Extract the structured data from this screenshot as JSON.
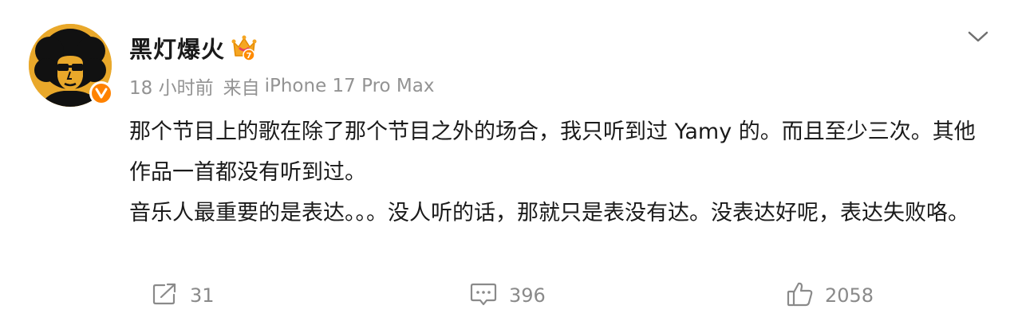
{
  "post": {
    "username": "黑灯爆火",
    "time": "18 小时前",
    "from_label": "来自",
    "device": "iPhone 17 Pro Max",
    "vip_level": "7",
    "paragraphs": [
      "那个节目上的歌在除了那个节目之外的场合，我只听到过 Yamy 的。而且至少三次。其他作品一首都没有听到过。",
      "音乐人最重要的是表达。。。没人听的话，那就只是表没有达。没表达好呢，表达失败咯。"
    ]
  },
  "actions": {
    "repost": {
      "icon": "repost-icon",
      "count": "31"
    },
    "comment": {
      "icon": "comment-icon",
      "count": "396"
    },
    "like": {
      "icon": "thumbs-up-icon",
      "count": "2058"
    }
  },
  "colors": {
    "username": "#1a1a1a",
    "meta": "#939393",
    "counts": "#8a8a8a",
    "verified_badge": "#ff8200",
    "avatar_background": "#e9a82a"
  }
}
